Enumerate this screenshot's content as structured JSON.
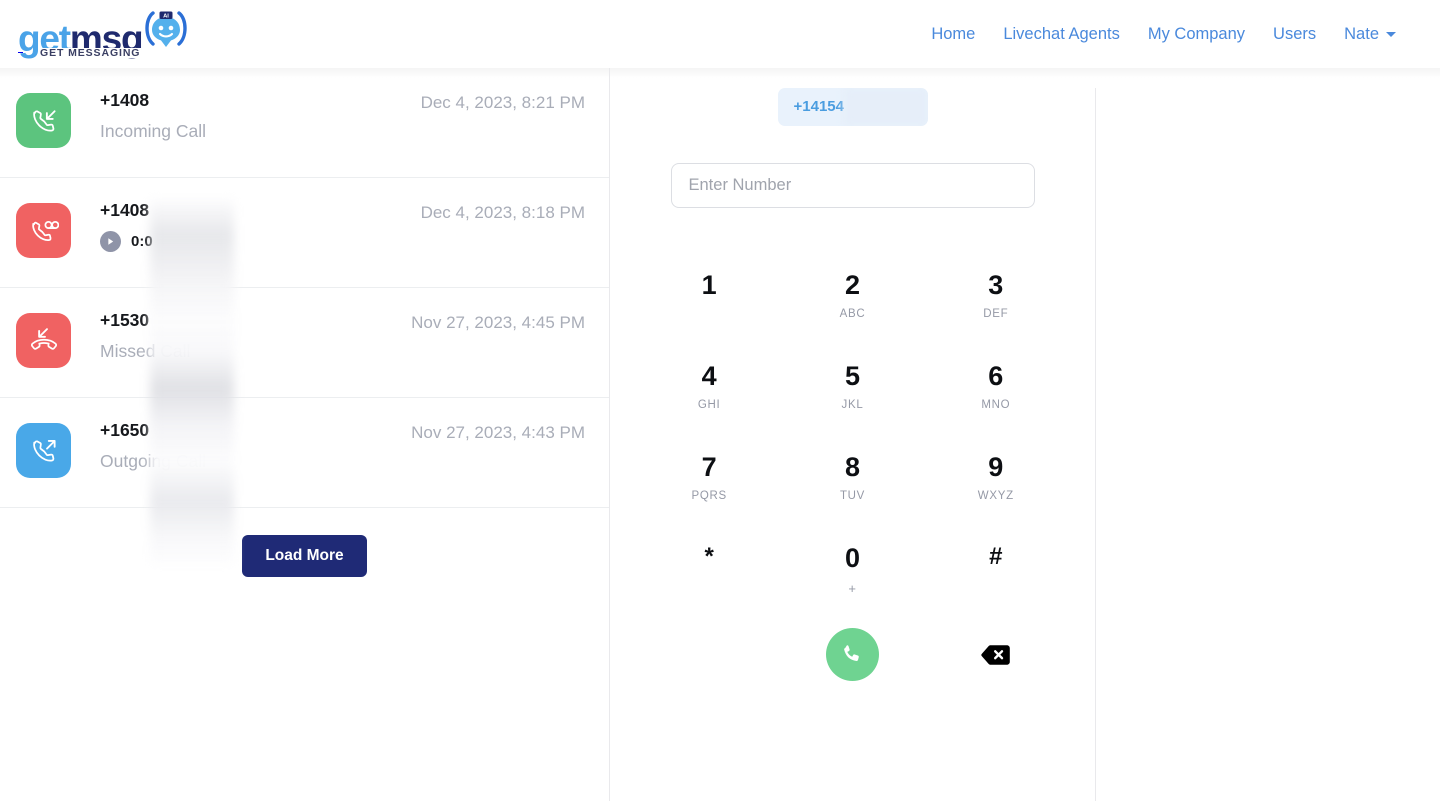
{
  "brand": {
    "logo_get": "get",
    "logo_msg": "msg",
    "logo_subtitle": "GET MESSAGING",
    "logo_badge": "AI",
    "color_light_blue": "#4aa3e8",
    "color_navy": "#1f2a6e"
  },
  "nav": {
    "links": [
      {
        "label": "Home",
        "name": "nav-home"
      },
      {
        "label": "Livechat Agents",
        "name": "nav-livechat-agents"
      },
      {
        "label": "My Company",
        "name": "nav-my-company"
      },
      {
        "label": "Users",
        "name": "nav-users"
      }
    ],
    "user_menu": {
      "label": "Nate"
    },
    "link_color": "#4a89dc"
  },
  "call_list": {
    "rows": [
      {
        "number": "+1408",
        "status": "Incoming Call",
        "timestamp": "Dec 4, 2023, 8:21 PM",
        "icon": "incoming-call-icon",
        "icon_color": "#5cc47e",
        "has_voicemail": false,
        "duration": ""
      },
      {
        "number": "+1408",
        "status": "",
        "timestamp": "Dec 4, 2023, 8:18 PM",
        "icon": "voicemail-icon",
        "icon_color": "#f06262",
        "has_voicemail": true,
        "duration": "0:0"
      },
      {
        "number": "+1530",
        "status": "Missed Call",
        "timestamp": "Nov 27, 2023, 4:45 PM",
        "icon": "missed-call-icon",
        "icon_color": "#f06262",
        "has_voicemail": false,
        "duration": ""
      },
      {
        "number": "+1650",
        "status": "Outgoing Call",
        "timestamp": "Nov 27, 2023, 4:43 PM",
        "icon": "outgoing-call-icon",
        "icon_color": "#49a8e8",
        "has_voicemail": false,
        "duration": ""
      }
    ],
    "load_more_label": "Load More",
    "load_more_color": "#1f2a76"
  },
  "dialer": {
    "caller_id": "+14154",
    "input_placeholder": "Enter Number",
    "input_value": "",
    "keys": [
      {
        "digit": "1",
        "letters": ""
      },
      {
        "digit": "2",
        "letters": "ABC"
      },
      {
        "digit": "3",
        "letters": "DEF"
      },
      {
        "digit": "4",
        "letters": "GHI"
      },
      {
        "digit": "5",
        "letters": "JKL"
      },
      {
        "digit": "6",
        "letters": "MNO"
      },
      {
        "digit": "7",
        "letters": "PQRS"
      },
      {
        "digit": "8",
        "letters": "TUV"
      },
      {
        "digit": "9",
        "letters": "WXYZ"
      },
      {
        "digit": "*",
        "letters": ""
      },
      {
        "digit": "0",
        "letters": "+"
      },
      {
        "digit": "#",
        "letters": ""
      }
    ],
    "call_button_color": "#6fd391",
    "call_button_icon": "phone-icon",
    "backspace_icon": "backspace-icon"
  }
}
